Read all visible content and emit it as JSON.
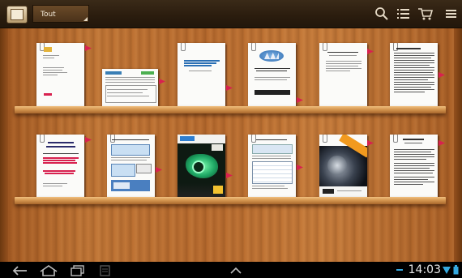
{
  "toolbar": {
    "filter_label": "Tout",
    "app_icon": "bookshelf-icon",
    "actions": [
      "search-icon",
      "list-view-icon",
      "shopping-cart-icon",
      "overflow-menu-icon"
    ]
  },
  "shelves": [
    {
      "books": [
        {
          "kind": "memo"
        },
        {
          "kind": "form"
        },
        {
          "kind": "report-blue"
        },
        {
          "kind": "logo-report"
        },
        {
          "kind": "article"
        },
        {
          "kind": "dense-text"
        }
      ]
    },
    {
      "books": [
        {
          "kind": "guide-red"
        },
        {
          "kind": "screenshots"
        },
        {
          "kind": "magazine-green"
        },
        {
          "kind": "table-doc"
        },
        {
          "kind": "poster-dark"
        },
        {
          "kind": "article-2"
        }
      ]
    }
  ],
  "statusbar": {
    "time": "14:03",
    "nav_icons": [
      "back-icon",
      "home-icon",
      "recent-apps-icon",
      "screenshot-icon",
      "chevron-up-icon"
    ],
    "status_icons": [
      "wifi-icon",
      "battery-icon"
    ]
  },
  "colors": {
    "bookmark_tab": "#d8214f",
    "wood": "#b86b2e",
    "status_accent": "#35a9e0"
  }
}
